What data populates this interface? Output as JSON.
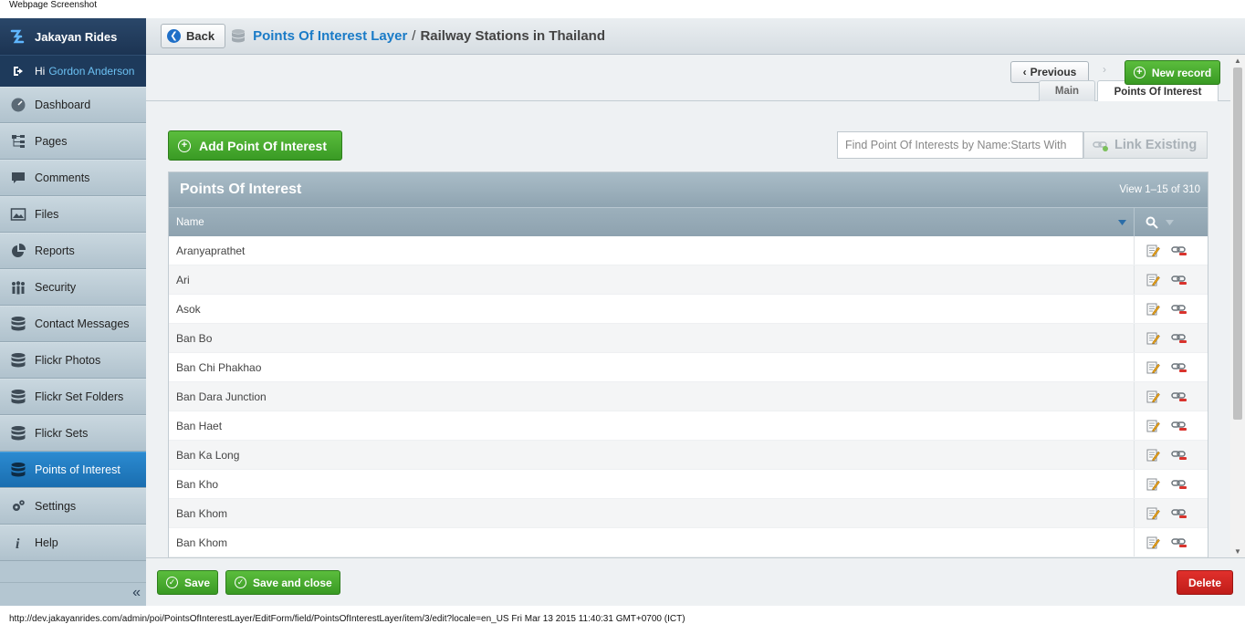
{
  "caption": "Webpage Screenshot",
  "footer_url": "http://dev.jakayanrides.com/admin/poi/PointsOfInterestLayer/EditForm/field/PointsOfInterestLayer/item/3/edit?locale=en_US Fri Mar 13 2015 11:40:31 GMT+0700 (ICT)",
  "brand": {
    "name": "Jakayan Rides",
    "icon": "brand-logo-icon"
  },
  "user": {
    "greeting": "Hi",
    "name": "Gordon Anderson",
    "icon": "logout-icon"
  },
  "nav": [
    {
      "label": "Dashboard",
      "icon": "dashboard-icon"
    },
    {
      "label": "Pages",
      "icon": "sitemap-icon"
    },
    {
      "label": "Comments",
      "icon": "comment-icon"
    },
    {
      "label": "Files",
      "icon": "image-icon"
    },
    {
      "label": "Reports",
      "icon": "pie-chart-icon"
    },
    {
      "label": "Security",
      "icon": "users-icon"
    },
    {
      "label": "Contact Messages",
      "icon": "database-icon"
    },
    {
      "label": "Flickr Photos",
      "icon": "database-icon"
    },
    {
      "label": "Flickr Set Folders",
      "icon": "database-icon"
    },
    {
      "label": "Flickr Sets",
      "icon": "database-icon"
    },
    {
      "label": "Points of Interest",
      "icon": "database-icon",
      "active": true
    },
    {
      "label": "Settings",
      "icon": "gears-icon"
    },
    {
      "label": "Help",
      "icon": "info-icon"
    }
  ],
  "collapse_glyph": "«",
  "header": {
    "back_label": "Back",
    "breadcrumb_link": "Points Of Interest Layer",
    "breadcrumb_sep": "/",
    "breadcrumb_current": "Railway Stations in Thailand"
  },
  "toolbar": {
    "previous_label": "Previous",
    "previous_glyph": "‹",
    "next_glyph": "›",
    "new_label": "New record"
  },
  "tabs": {
    "main": "Main",
    "poi": "Points Of Interest"
  },
  "content": {
    "add_label": "Add Point Of Interest",
    "find_placeholder": "Find Point Of Interests by Name:Starts With",
    "link_label": "Link Existing"
  },
  "grid": {
    "title": "Points Of Interest",
    "count": "View 1–15 of 310",
    "column_name": "Name",
    "rows": [
      "Aranyaprathet",
      "Ari",
      "Asok",
      "Ban Bo",
      "Ban Chi Phakhao",
      "Ban Dara Junction",
      "Ban Haet",
      "Ban Ka Long",
      "Ban Kho",
      "Ban Khom",
      "Ban Khom"
    ]
  },
  "bottom": {
    "save_label": "Save",
    "save_close_label": "Save and close",
    "delete_label": "Delete"
  },
  "colors": {
    "accent_green": "#399a24",
    "link_blue": "#1a7bc7",
    "delete_red": "#c01d19",
    "nav_active": "#1a6eb0"
  }
}
